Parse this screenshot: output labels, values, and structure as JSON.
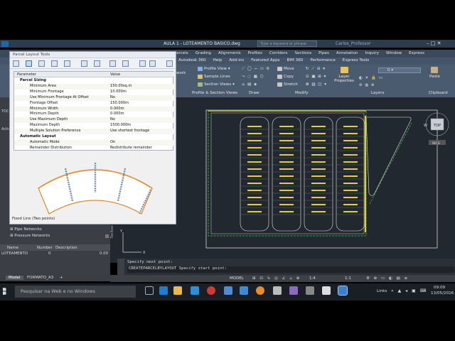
{
  "window": {
    "tabs_label": "AULA 1 - LOTEAMENTO BASICO.dwg",
    "search_placeholder": "Type a keyword or phrase",
    "user": "Carlos_Professor"
  },
  "menubar": [
    "Parcels",
    "Grading",
    "Alignments",
    "Profiles",
    "Corridors",
    "Sections",
    "Pipes",
    "Annotation",
    "Inquiry",
    "Window",
    "Express"
  ],
  "ribbon_tabs": [
    "Autodesk 360",
    "Help",
    "Add-ins",
    "Featured Apps",
    "BIM 360",
    "Performance",
    "Express Tools"
  ],
  "ribbon": {
    "profile_view": "Profile View",
    "sample_lines": "Sample Lines",
    "section_views": "Section Views",
    "work": "work",
    "panel_profile_section": "Profile & Section Views",
    "draw": "Draw",
    "move": "Move",
    "copy": "Copy",
    "stretch": "Stretch",
    "modify": "Modify",
    "layer_properties": "Layer Properties",
    "layers": "Layers",
    "paste": "Paste",
    "clipboard": "Clipboard",
    "layer_value": "0"
  },
  "dialog": {
    "title": "Parcel Layout Tools",
    "header_param": "Parameter",
    "header_value": "Value",
    "rows": [
      {
        "p": "Parcel Sizing",
        "v": "",
        "cat": true
      },
      {
        "p": "Minimum Area",
        "v": "150.00sq.m"
      },
      {
        "p": "Minimum Frontage",
        "v": "10.000m"
      },
      {
        "p": "Use Minimum Frontage At Offset",
        "v": "No"
      },
      {
        "p": "Frontage Offset",
        "v": "150.000m"
      },
      {
        "p": "Minimum Width",
        "v": "0.000m"
      },
      {
        "p": "Minimum Depth",
        "v": "0.000m"
      },
      {
        "p": "Use Maximum Depth",
        "v": "No"
      },
      {
        "p": "Maximum Depth",
        "v": "1500.000m"
      },
      {
        "p": "Multiple Solution Preference",
        "v": "Use shortest frontage"
      },
      {
        "p": "Automatic Layout",
        "v": "",
        "cat": true
      },
      {
        "p": "Automatic Mode",
        "v": "On"
      },
      {
        "p": "Remainder Distribution",
        "v": "Redistribute remainder"
      }
    ],
    "status": "Fixed Line (Two points)"
  },
  "toolspace": {
    "label_toolspace": "Toolspace",
    "tree": [
      "Pipe Networks",
      "Pressure Networks"
    ],
    "table_headers": [
      "Name",
      "Number",
      "Description"
    ],
    "table_row": {
      "name": "LOTEAMENTO",
      "number": "0",
      "extra": "0.00"
    }
  },
  "command": {
    "line1": "Specify next point:",
    "line2": "CREATEPARCELBYLAYOUT Specify start point:"
  },
  "layout_tabs": [
    "Model",
    "FORMATO_A3"
  ],
  "statusbar": {
    "model": "MODEL",
    "scale": "1:1",
    "value": "1:4"
  },
  "taskbar": {
    "search": "Pesquisar na Web e no Windows",
    "links": "Links",
    "time": "09:09",
    "date": "13/05/2016"
  },
  "viewcube": {
    "top": "TOP",
    "w": "W",
    "wcs": "WCS"
  },
  "colors": {
    "drawing_bg": "#212830",
    "parcel_line": "#e6e6e6",
    "lot_label": "#ffff00",
    "right_of_way": "#44c244",
    "preview_orange": "#e08a2a"
  }
}
